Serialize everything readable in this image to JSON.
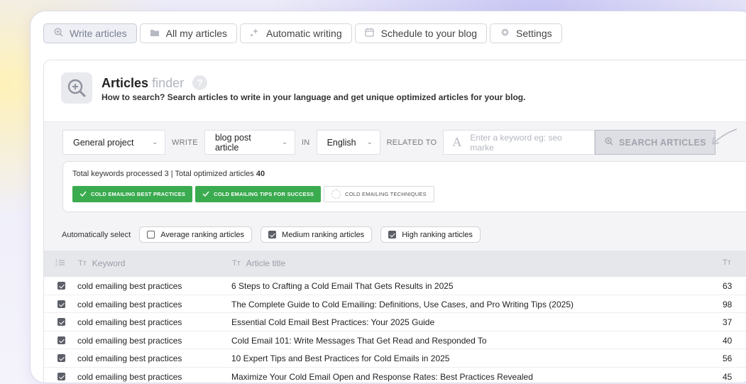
{
  "tabs": [
    {
      "label": "Write articles",
      "icon": "search-plus-icon",
      "active": true
    },
    {
      "label": "All my articles",
      "icon": "folder-icon",
      "active": false
    },
    {
      "label": "Automatic writing",
      "icon": "sparkle-icon",
      "active": false
    },
    {
      "label": "Schedule to your blog",
      "icon": "calendar-icon",
      "active": false
    },
    {
      "label": "Settings",
      "icon": "gear-icon",
      "active": false
    }
  ],
  "finder": {
    "title_bold": "Articles",
    "title_light": "finder",
    "help": "?",
    "subtitle": "How to search? Search articles to write in your language and get unique optimized articles for your blog."
  },
  "search": {
    "project": "General project",
    "write_label": "WRITE",
    "type": "blog post article",
    "in_label": "IN",
    "language": "English",
    "related_label": "RELATED TO",
    "placeholder": "Enter a keyword eg: seo marke",
    "button": "SEARCH ARTICLES"
  },
  "stats": {
    "prefix": "Total keywords processed 3 | Total optimized articles ",
    "count": "40",
    "chips": [
      {
        "label": "COLD EMAILING BEST PRACTICES",
        "selected": true
      },
      {
        "label": "COLD EMAILING TIPS FOR SUCCESS",
        "selected": true
      },
      {
        "label": "COLD EMAILING TECHNIQUES",
        "selected": false
      }
    ]
  },
  "auto_select": {
    "label": "Automatically select",
    "options": [
      {
        "label": "Average ranking articles",
        "checked": false
      },
      {
        "label": "Medium ranking articles",
        "checked": true
      },
      {
        "label": "High ranking articles",
        "checked": true
      }
    ]
  },
  "table": {
    "headers": {
      "keyword": "Keyword",
      "title": "Article title",
      "third": "Tт"
    },
    "rows": [
      {
        "checked": true,
        "keyword": "cold emailing best practices",
        "title": "6 Steps to Crafting a Cold Email That Gets Results in 2025",
        "value": "63"
      },
      {
        "checked": true,
        "keyword": "cold emailing best practices",
        "title": "The Complete Guide to Cold Emailing: Definitions, Use Cases, and Pro Writing Tips (2025)",
        "value": "98"
      },
      {
        "checked": true,
        "keyword": "cold emailing best practices",
        "title": "Essential Cold Email Best Practices: Your 2025 Guide",
        "value": "37"
      },
      {
        "checked": true,
        "keyword": "cold emailing best practices",
        "title": "Cold Email 101: Write Messages That Get Read and Responded To",
        "value": "40"
      },
      {
        "checked": true,
        "keyword": "cold emailing best practices",
        "title": "10 Expert Tips and Best Practices for Cold Emails in 2025",
        "value": "56"
      },
      {
        "checked": true,
        "keyword": "cold emailing best practices",
        "title": "Maximize Your Cold Email Open and Response Rates: Best Practices Revealed",
        "value": "45"
      }
    ]
  }
}
